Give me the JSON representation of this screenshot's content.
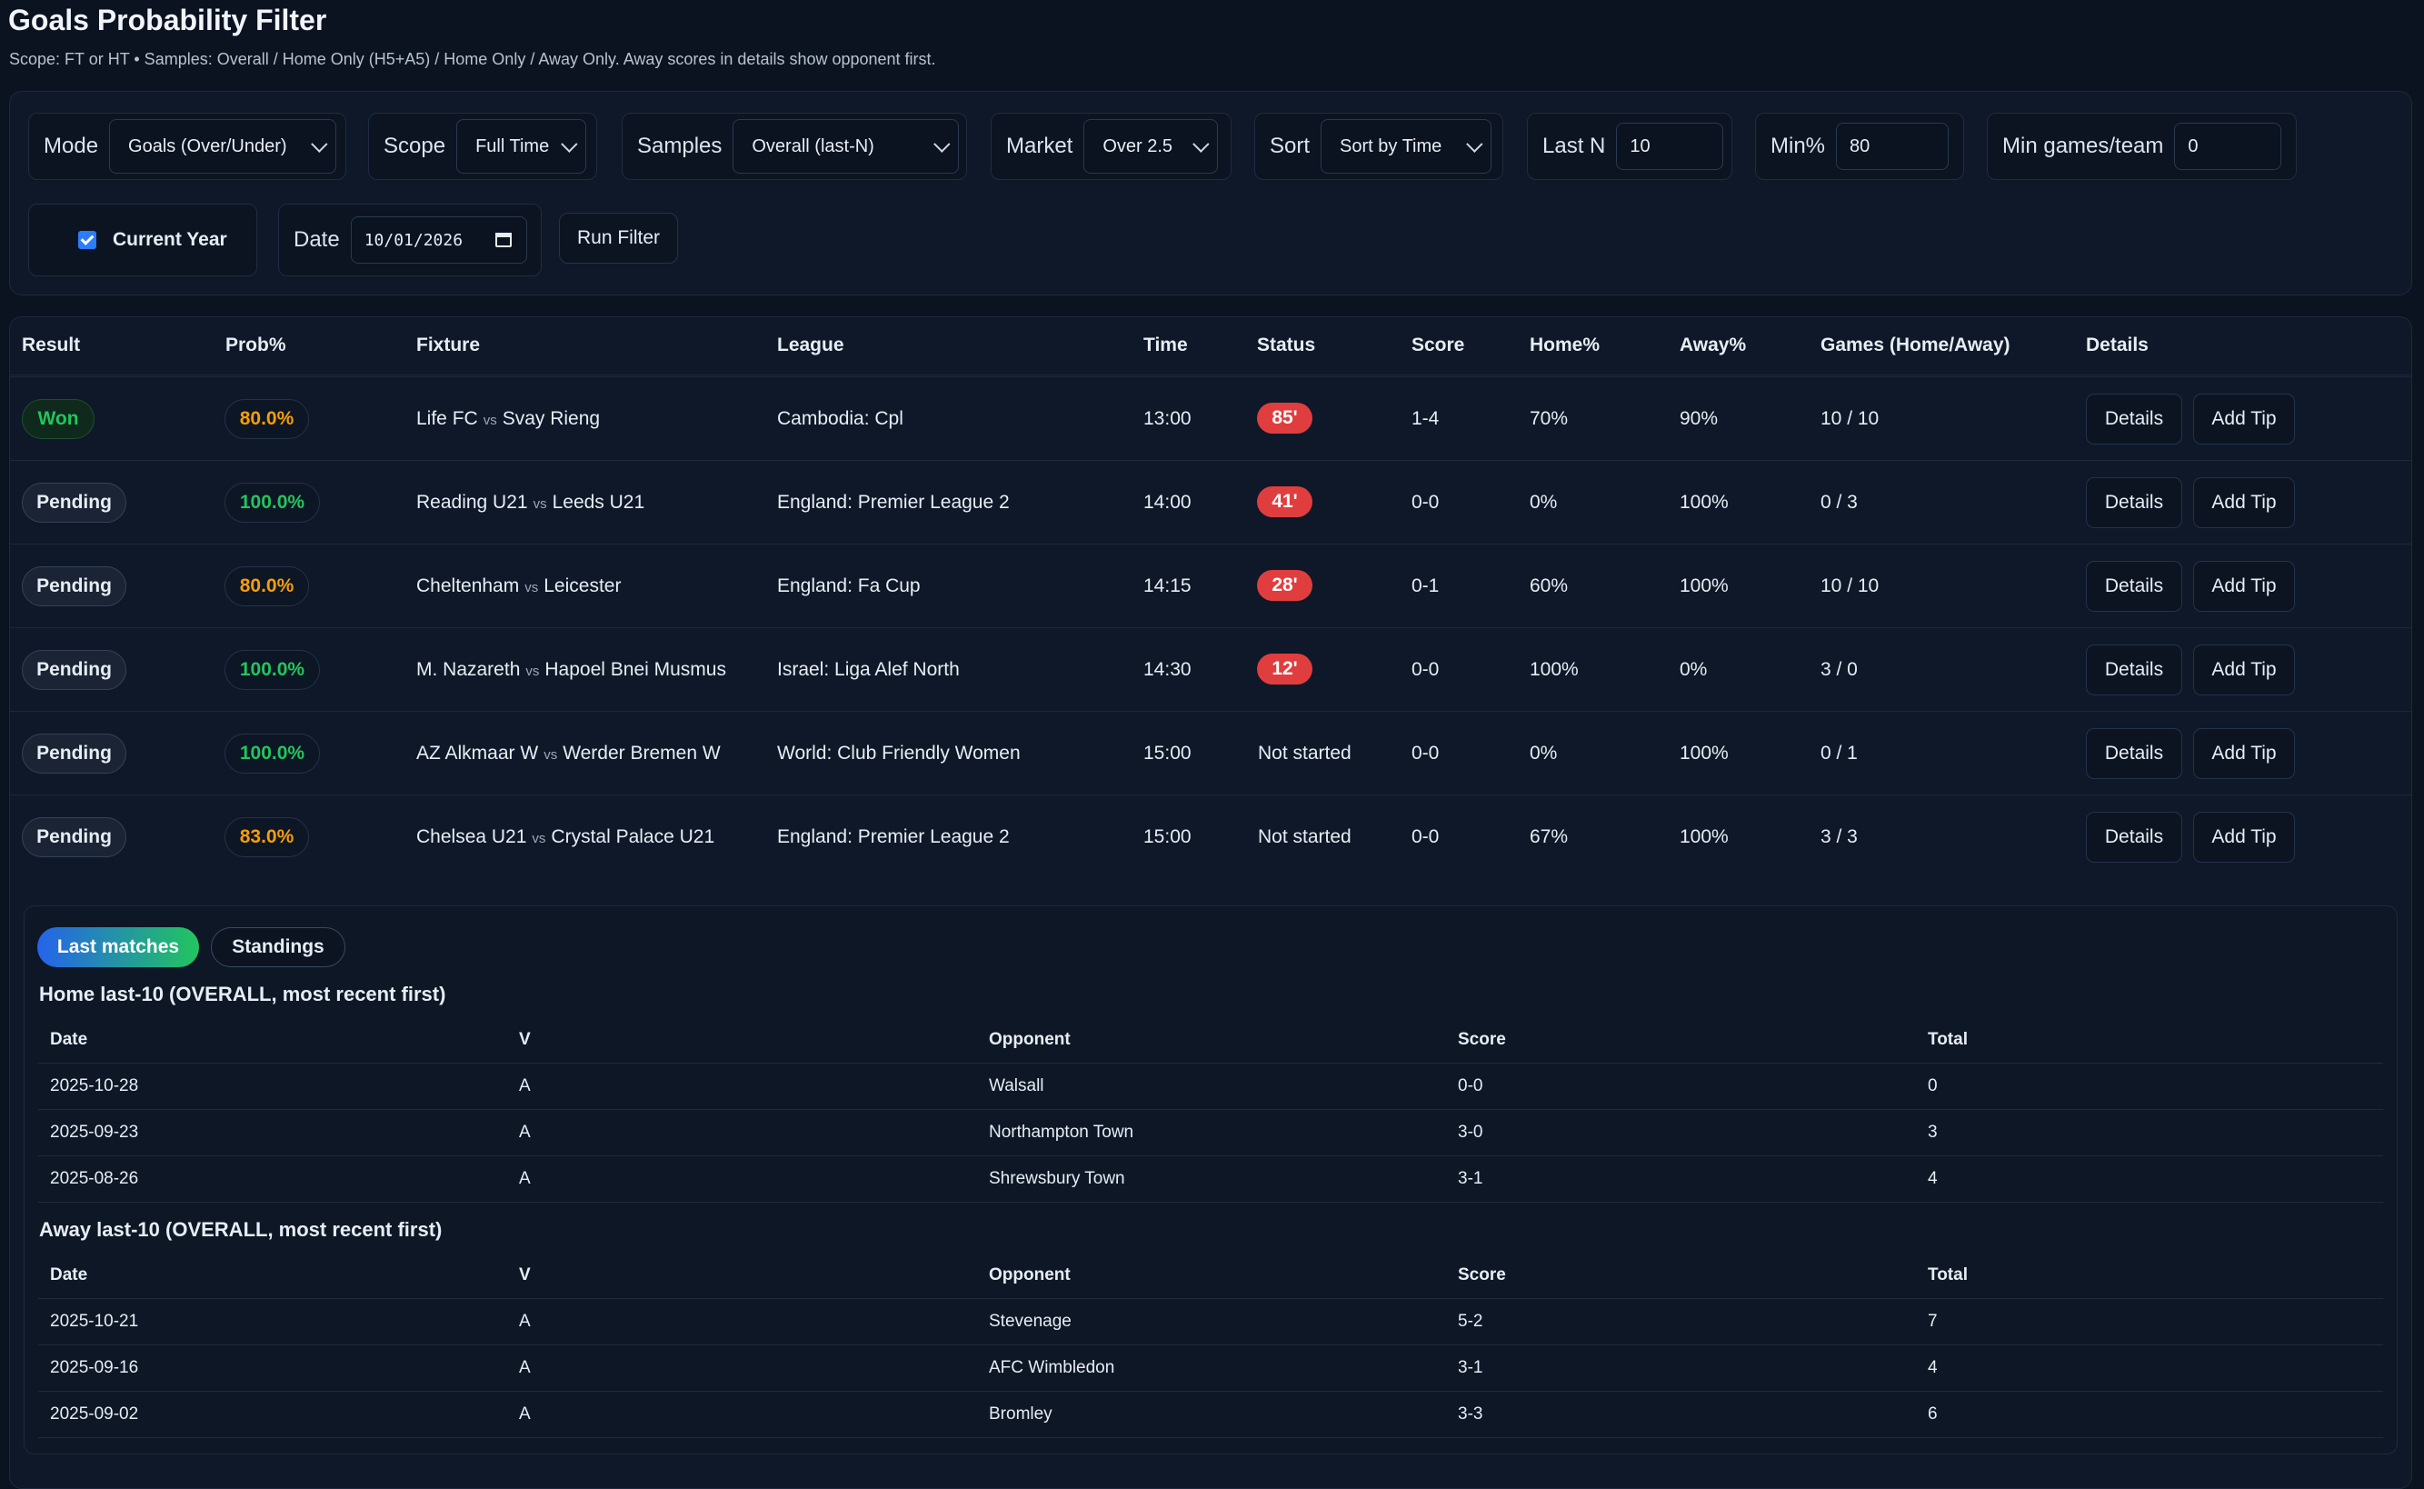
{
  "page": {
    "title": "Goals Probability Filter",
    "subtitle": "Scope: FT or HT • Samples: Overall / Home Only (H5+A5) / Home Only / Away Only. Away scores in details show opponent first."
  },
  "filters": {
    "mode_label": "Mode",
    "mode_value": "Goals (Over/Under)",
    "scope_label": "Scope",
    "scope_value": "Full Time",
    "samples_label": "Samples",
    "samples_value": "Overall (last-N)",
    "market_label": "Market",
    "market_value": "Over 2.5",
    "sort_label": "Sort",
    "sort_value": "Sort by Time",
    "lastn_label": "Last N",
    "lastn_value": "10",
    "minpct_label": "Min%",
    "minpct_value": "80",
    "mingames_label": "Min games/team",
    "mingames_value": "0",
    "current_year_label": "Current Year",
    "current_year_checked": true,
    "date_label": "Date",
    "date_value": "10/01/2026",
    "run_label": "Run Filter"
  },
  "table": {
    "headers": [
      "Result",
      "Prob%",
      "Fixture",
      "League",
      "Time",
      "Status",
      "Score",
      "Home%",
      "Away%",
      "Games (Home/Away)",
      "Details"
    ],
    "vs": "vs",
    "details_btn": "Details",
    "tip_btn": "Add Tip",
    "rows": [
      {
        "result": "Won",
        "prob": "80.0%",
        "home": "Life FC",
        "away": "Svay Rieng",
        "league": "Cambodia: Cpl",
        "time": "13:00",
        "status": "85'",
        "live": true,
        "score": "1-4",
        "home_pct": "70%",
        "away_pct": "90%",
        "games": "10 / 10"
      },
      {
        "result": "Pending",
        "prob": "100.0%",
        "home": "Reading U21",
        "away": "Leeds U21",
        "league": "England: Premier League 2",
        "time": "14:00",
        "status": "41'",
        "live": true,
        "score": "0-0",
        "home_pct": "0%",
        "away_pct": "100%",
        "games": "0 / 3"
      },
      {
        "result": "Pending",
        "prob": "80.0%",
        "home": "Cheltenham",
        "away": "Leicester",
        "league": "England: Fa Cup",
        "time": "14:15",
        "status": "28'",
        "live": true,
        "score": "0-1",
        "home_pct": "60%",
        "away_pct": "100%",
        "games": "10 / 10"
      },
      {
        "result": "Pending",
        "prob": "100.0%",
        "home": "M. Nazareth",
        "away": "Hapoel Bnei Musmus",
        "league": "Israel: Liga Alef North",
        "time": "14:30",
        "status": "12'",
        "live": true,
        "score": "0-0",
        "home_pct": "100%",
        "away_pct": "0%",
        "games": "3 / 0"
      },
      {
        "result": "Pending",
        "prob": "100.0%",
        "home": "AZ Alkmaar W",
        "away": "Werder Bremen W",
        "league": "World: Club Friendly Women",
        "time": "15:00",
        "status": "Not started",
        "live": false,
        "score": "0-0",
        "home_pct": "0%",
        "away_pct": "100%",
        "games": "0 / 1"
      },
      {
        "result": "Pending",
        "prob": "83.0%",
        "home": "Chelsea U21",
        "away": "Crystal Palace U21",
        "league": "England: Premier League 2",
        "time": "15:00",
        "status": "Not started",
        "live": false,
        "score": "0-0",
        "home_pct": "67%",
        "away_pct": "100%",
        "games": "3 / 3"
      }
    ]
  },
  "details": {
    "tab_last": "Last matches",
    "tab_standings": "Standings",
    "columns": [
      "Date",
      "V",
      "Opponent",
      "Score",
      "Total"
    ],
    "home_title": "Home last-10 (OVERALL, most recent first)",
    "home_rows": [
      [
        "2025-10-28",
        "A",
        "Walsall",
        "0-0",
        "0"
      ],
      [
        "2025-09-23",
        "A",
        "Northampton Town",
        "3-0",
        "3"
      ],
      [
        "2025-08-26",
        "A",
        "Shrewsbury Town",
        "3-1",
        "4"
      ]
    ],
    "away_title": "Away last-10 (OVERALL, most recent first)",
    "away_rows": [
      [
        "2025-10-21",
        "A",
        "Stevenage",
        "5-2",
        "7"
      ],
      [
        "2025-09-16",
        "A",
        "AFC Wimbledon",
        "3-1",
        "4"
      ],
      [
        "2025-09-02",
        "A",
        "Bromley",
        "3-3",
        "6"
      ]
    ]
  },
  "colors": {
    "won": "#22c55e",
    "pending": "#e6edf5",
    "prob_orange": "#f59e0b",
    "prob_green": "#22c55e",
    "live_red": "#e03e3e",
    "accent_gradient": "linear-gradient(90deg,#2563eb,#22c55e)"
  }
}
